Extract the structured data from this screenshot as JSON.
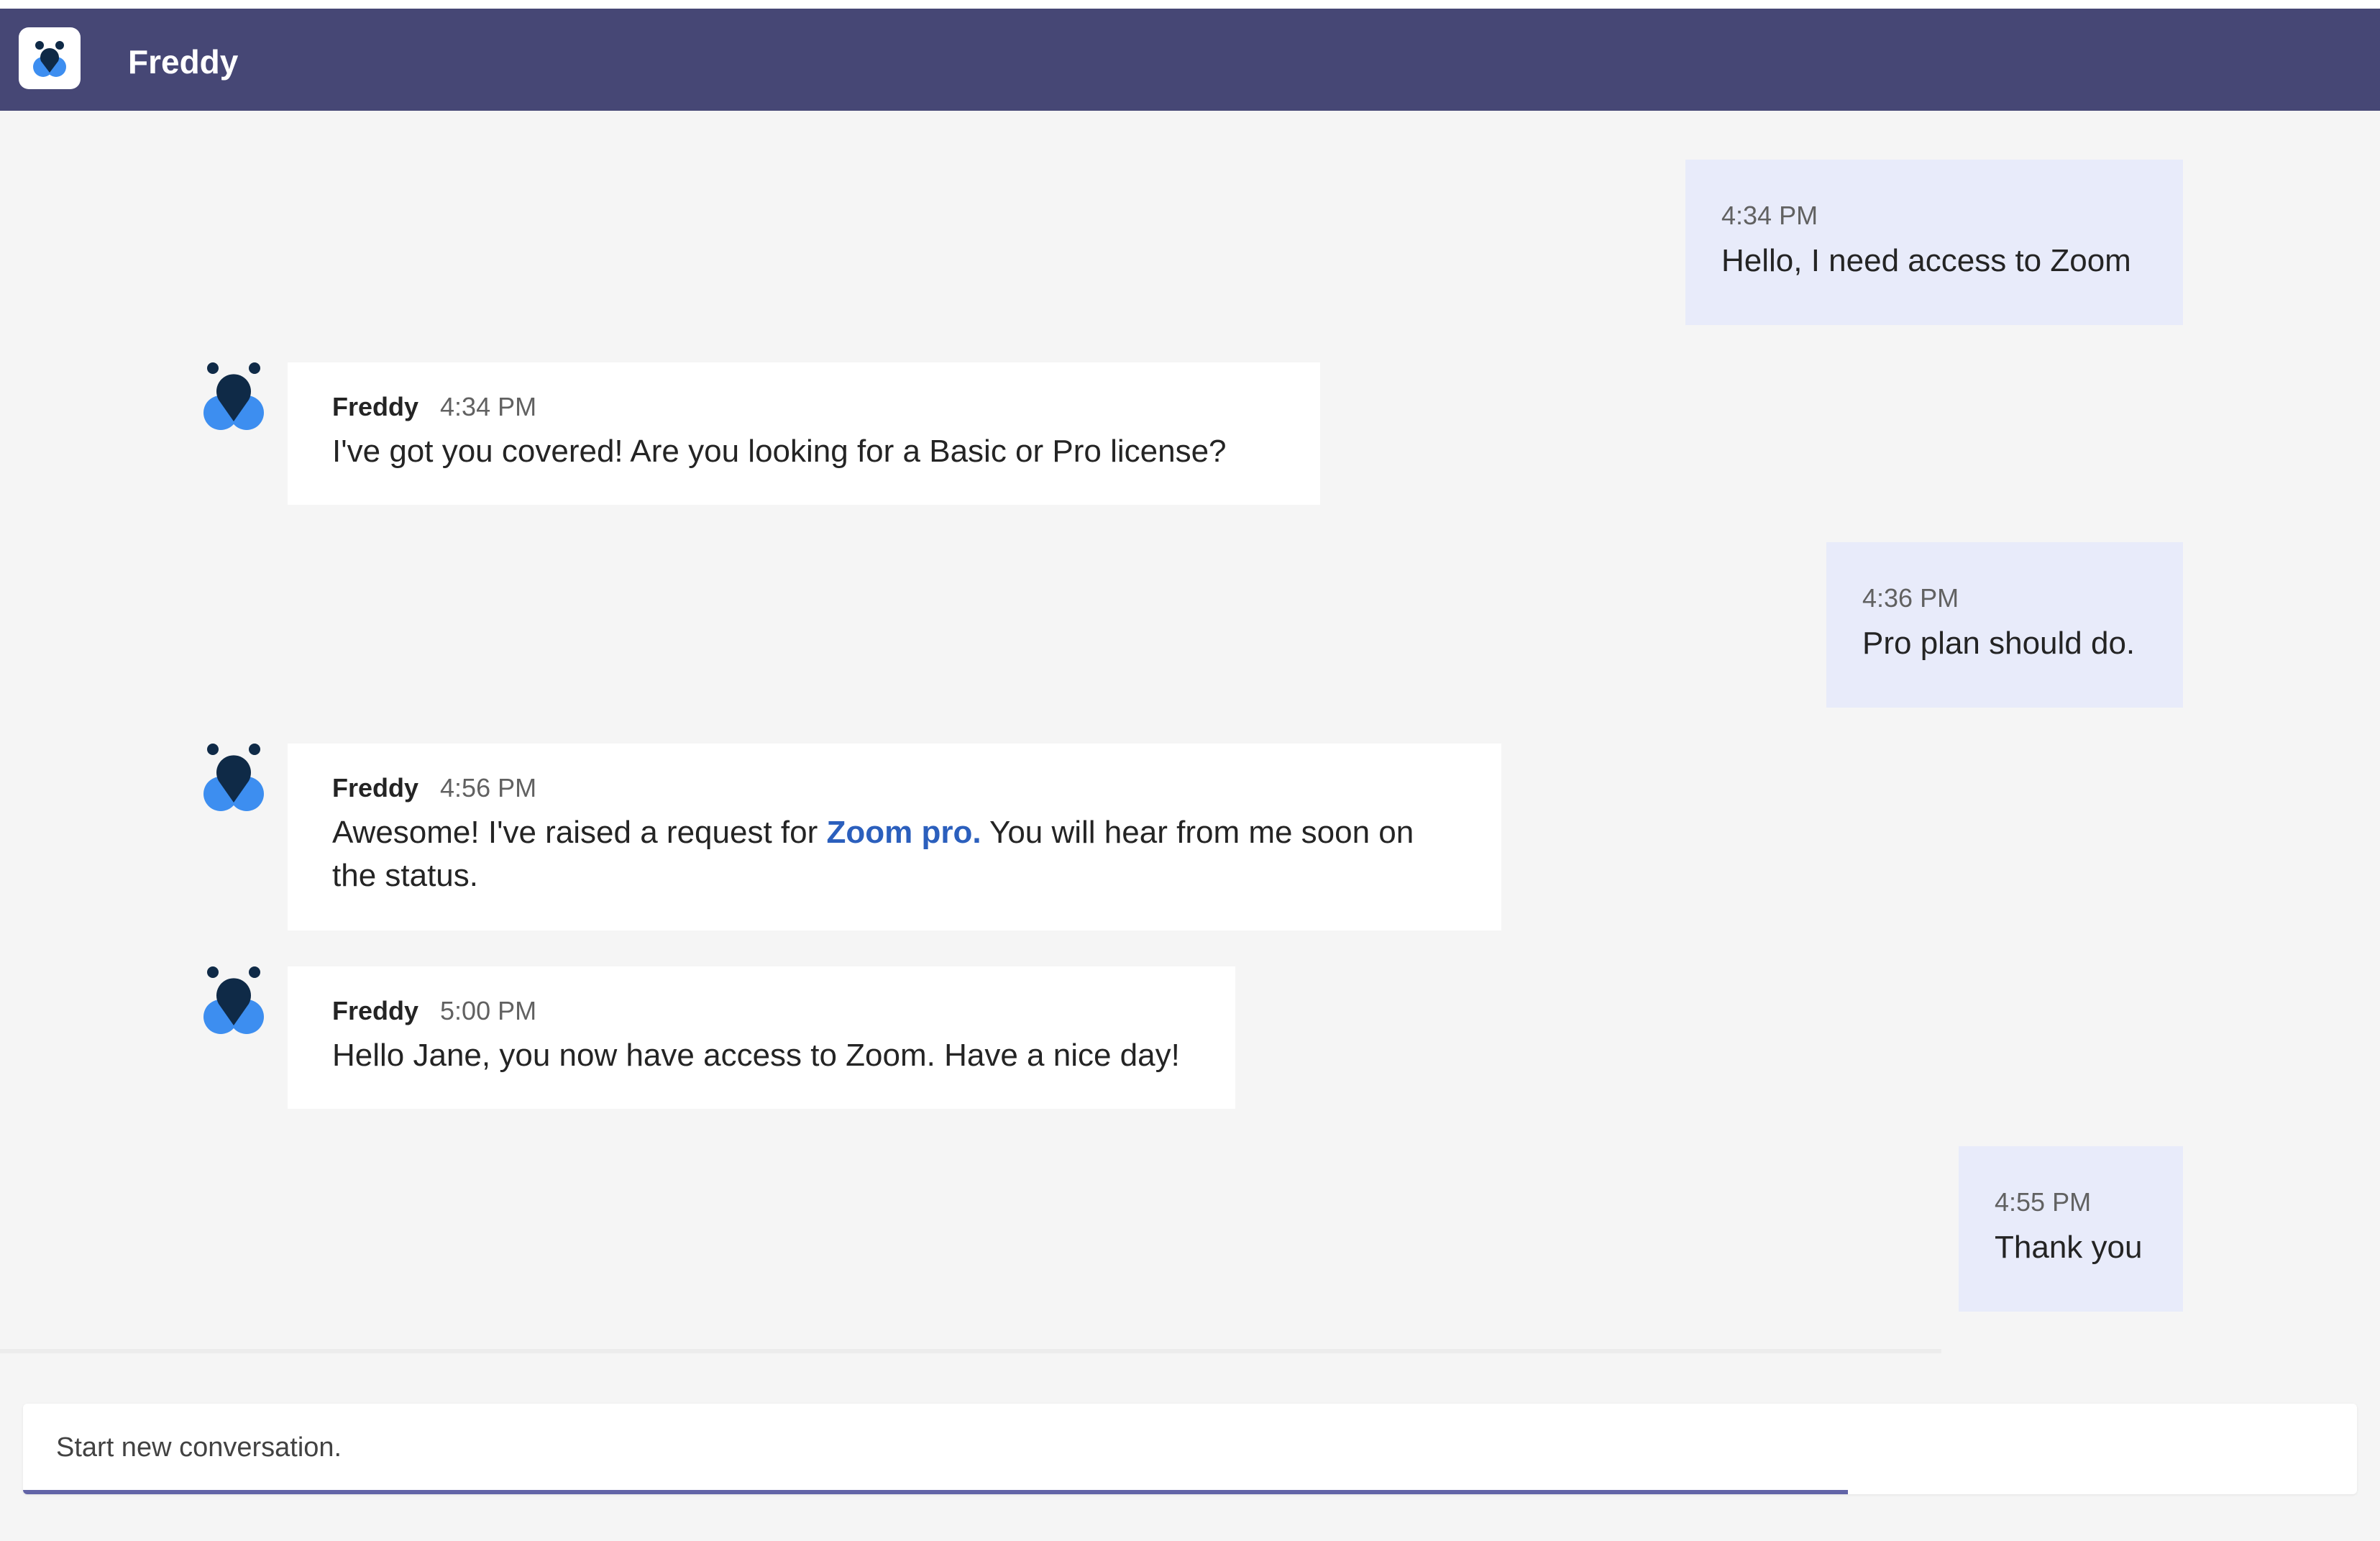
{
  "header": {
    "title": "Freddy",
    "icon": "freddy-bot-icon",
    "background": "#464775"
  },
  "messages": [
    {
      "kind": "user",
      "time": "4:34 PM",
      "text": "Hello, I need access to Zoom"
    },
    {
      "kind": "bot",
      "sender": "Freddy",
      "time": "4:34 PM",
      "text": "I've got you covered! Are you looking for a Basic or Pro license?"
    },
    {
      "kind": "user",
      "time": "4:36 PM",
      "text": "Pro plan should do."
    },
    {
      "kind": "bot",
      "sender": "Freddy",
      "time": "4:56 PM",
      "text_before": "Awesome! I've raised a request for ",
      "link": "Zoom pro.",
      "text_after": " You will hear from me soon on the status."
    },
    {
      "kind": "bot",
      "sender": "Freddy",
      "time": "5:00 PM",
      "text": "Hello Jane, you now have access to Zoom. Have a nice day!"
    },
    {
      "kind": "user",
      "time": "4:55 PM",
      "text": "Thank you"
    }
  ],
  "composer": {
    "placeholder": "Start new conversation."
  },
  "colors": {
    "user_bubble": "#e8ebfa",
    "bot_bubble": "#ffffff",
    "link": "#2b5fbd",
    "accent": "#6264a7",
    "avatar_dark": "#0f2a47",
    "avatar_blue": "#3d8ef0"
  }
}
